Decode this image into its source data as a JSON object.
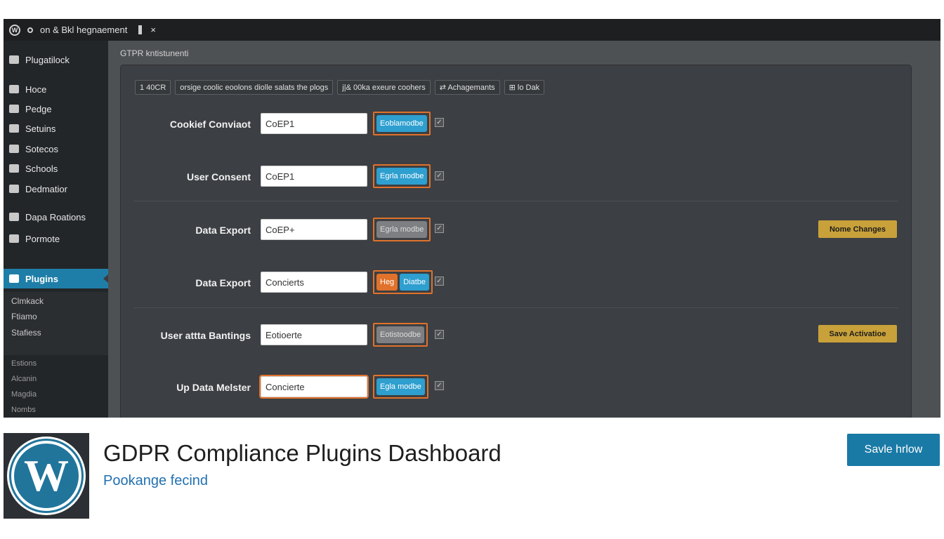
{
  "topbar": {
    "title": "on & Bkl hegnaement",
    "close": "×"
  },
  "sidebar": {
    "items": [
      {
        "label": "Plugatilock",
        "icon": "house-icon"
      },
      {
        "label": "Hoce",
        "icon": "user-icon"
      },
      {
        "label": "Pedge",
        "icon": "wrench-icon"
      },
      {
        "label": "Setuins",
        "icon": "house-icon"
      },
      {
        "label": "Sotecos",
        "icon": "square-icon"
      },
      {
        "label": "Schools",
        "icon": "speech-bubble-icon"
      },
      {
        "label": "Dedmatior",
        "icon": "gear-icon"
      },
      {
        "label": "Dapa Roations",
        "icon": "house-icon"
      },
      {
        "label": "Pormote",
        "icon": "pencil-icon"
      },
      {
        "label": "Plugins",
        "icon": "plugin-icon"
      }
    ],
    "submenu": [
      "Clmkack",
      "Ftiamo",
      "Stafiess"
    ],
    "extra": [
      "Estions",
      "Alcanin",
      "Magdia",
      "Nombs"
    ]
  },
  "page_header": "GTPR kntistunenti",
  "filters": [
    "1 40CR",
    "orsige coolic eoolons diolle salats the plogs",
    "j|& 00ka exeure coohers",
    "⇄ Achagemants",
    "⊞ lo Dak"
  ],
  "rows": [
    {
      "label": "Cookief Conviaot",
      "input": "CoEP1",
      "buttons": [
        {
          "label": "Eoblamodbe",
          "style": "blue"
        }
      ],
      "checked": "✓"
    },
    {
      "label": "User Consent",
      "input": "CoEP1",
      "buttons": [
        {
          "label": "Egrla modbe",
          "style": "blue"
        }
      ],
      "checked": "✓"
    },
    {
      "label": "Data Export",
      "input": "CoEP+",
      "buttons": [
        {
          "label": "Egrla modbe",
          "style": "gray"
        }
      ],
      "checked": "✓"
    },
    {
      "label": "Data Export",
      "input": "Concierts",
      "buttons": [
        {
          "label": "Heg",
          "style": "orange"
        },
        {
          "label": "Diatbe",
          "style": "blue"
        }
      ],
      "checked": "✓"
    },
    {
      "label": "User attta Bantings",
      "input": "Eotioerte",
      "buttons": [
        {
          "label": "Eotistoodbe",
          "style": "gray"
        }
      ],
      "checked": "✓"
    },
    {
      "label": "Up Data Melster",
      "input": "Concierte",
      "buttons": [
        {
          "label": "Egla modbe",
          "style": "blue"
        }
      ],
      "checked": "✓"
    }
  ],
  "actions": {
    "name_changes": "Nome Changes",
    "save_activation": "Save Activatioe"
  },
  "plugin": {
    "title": "GDPR Compliance Plugins Dashboard",
    "subtitle": "Pookange fecind",
    "save_now": "Savle hrlow",
    "logo_letter": "W"
  },
  "colors": {
    "accent_blue": "#2e9fcf",
    "highlight_orange": "#e0722b",
    "gold": "#c9a13a",
    "wp_blue": "#21759b"
  }
}
